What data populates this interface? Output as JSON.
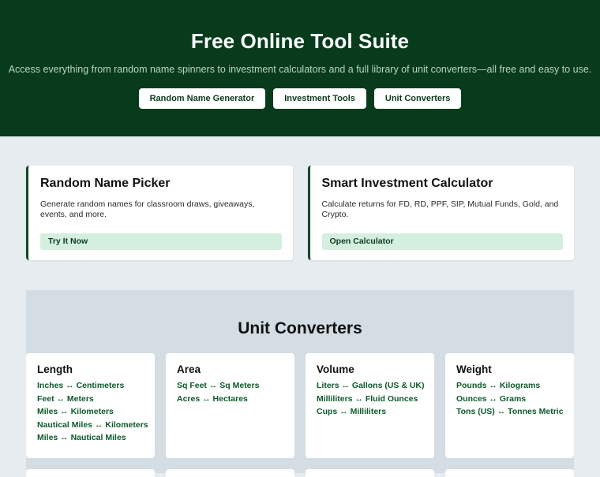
{
  "hero": {
    "title": "Free Online Tool Suite",
    "subtitle": "Access everything from random name spinners to investment calculators and a full library of unit converters—all free and easy to use.",
    "buttons": [
      "Random Name Generator",
      "Investment Tools",
      "Unit Converters"
    ]
  },
  "cards": [
    {
      "title": "Random Name Picker",
      "description": "Generate random names for classroom draws, giveaways, events, and more.",
      "button": "Try It Now"
    },
    {
      "title": "Smart Investment Calculator",
      "description": "Calculate returns for FD, RD, PPF, SIP, Mutual Funds, Gold, and Crypto.",
      "button": "Open Calculator"
    }
  ],
  "converters": {
    "title": "Unit Converters",
    "groups": [
      {
        "name": "Length",
        "links": [
          "Inches ↔ Centimeters",
          "Feet ↔ Meters",
          "Miles ↔ Kilometers",
          "Nautical Miles ↔ Kilometers",
          "Miles ↔ Nautical Miles"
        ]
      },
      {
        "name": "Area",
        "links": [
          "Sq Feet ↔ Sq Meters",
          "Acres ↔ Hectares"
        ]
      },
      {
        "name": "Volume",
        "links": [
          "Liters ↔ Gallons (US & UK)",
          "Milliliters ↔ Fluid Ounces",
          "Cups ↔ Milliliters"
        ]
      },
      {
        "name": "Weight",
        "links": [
          "Pounds ↔ Kilograms",
          "Ounces ↔ Grams",
          "Tons (US) ↔ Tonnes Metric"
        ]
      }
    ]
  },
  "colors": {
    "hero_bg": "#073b1c",
    "accent": "#0d4a26",
    "button_light": "#d4efdf",
    "link": "#0d5a2a"
  }
}
